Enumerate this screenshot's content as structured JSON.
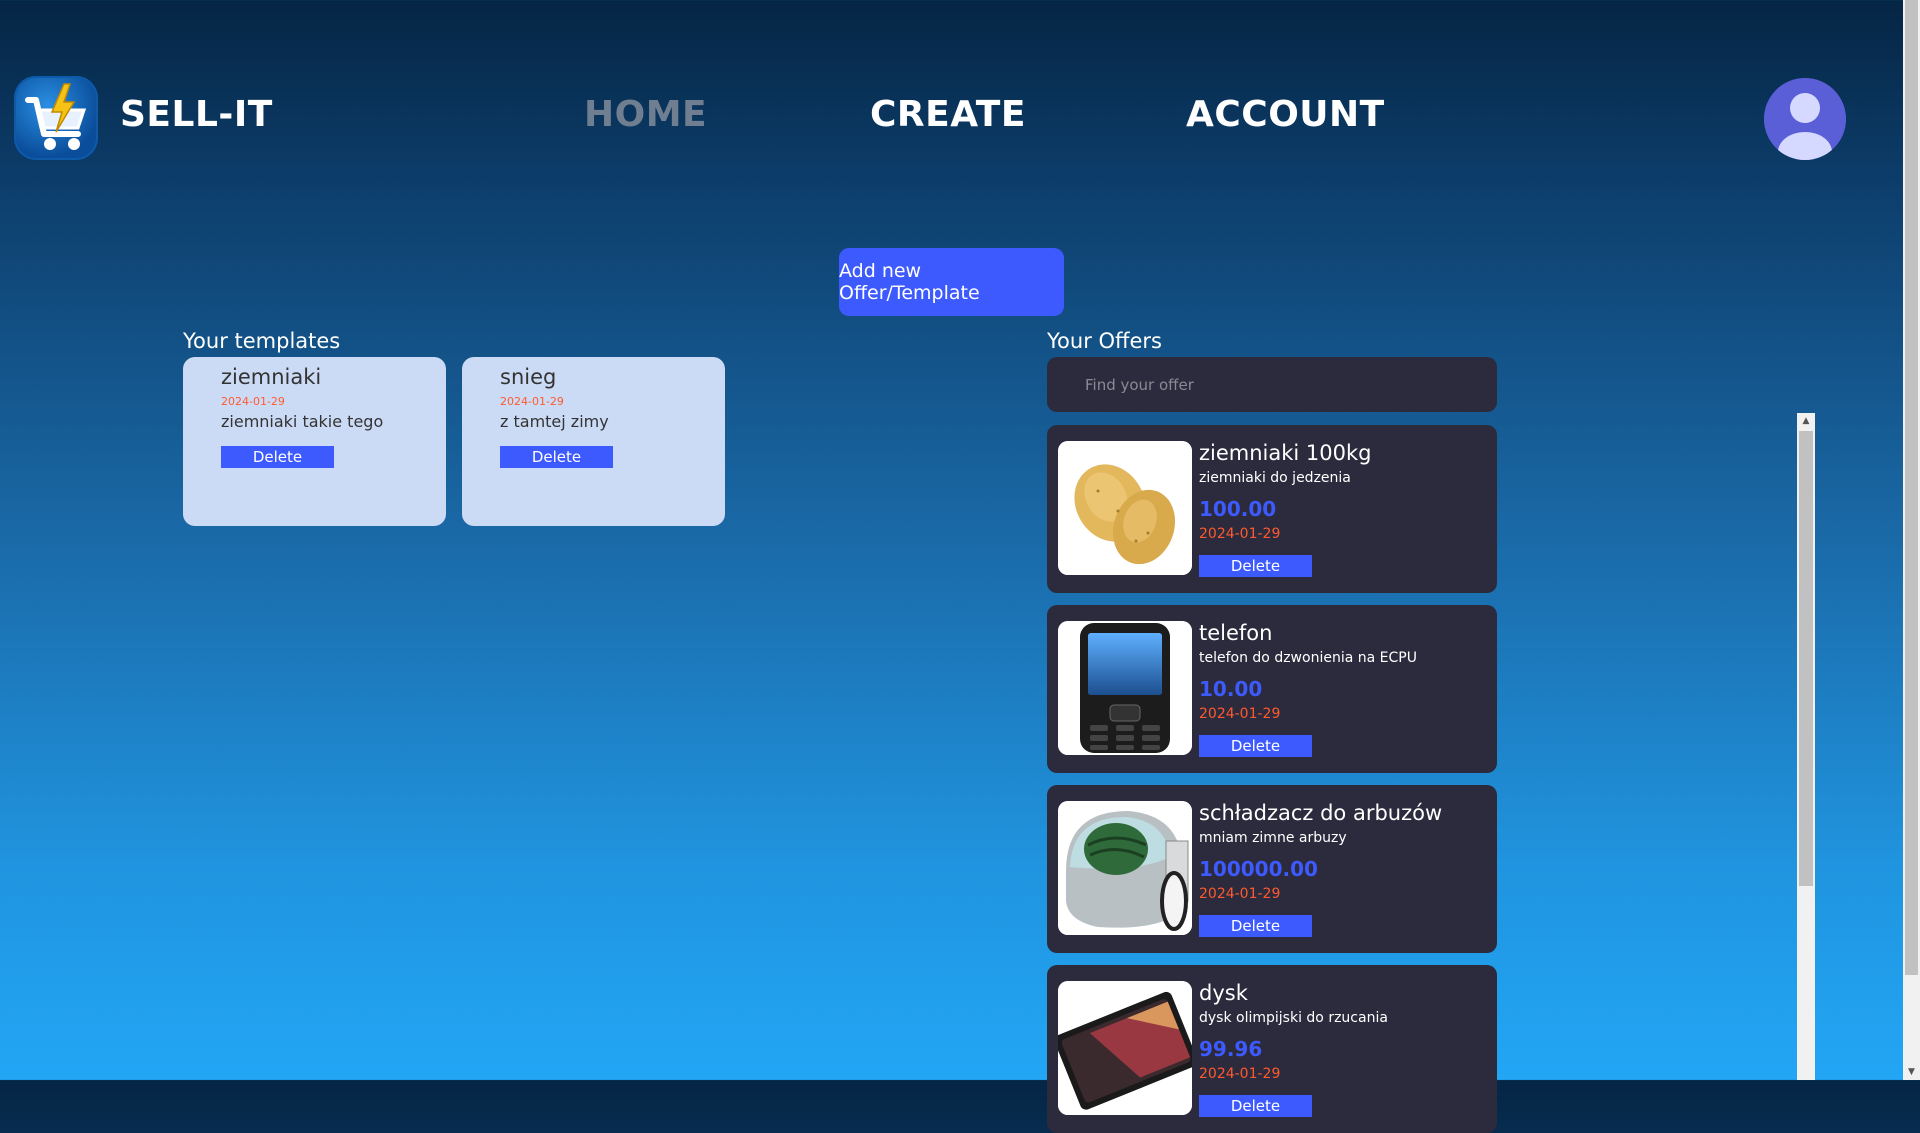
{
  "header": {
    "brand": "SELL-IT",
    "nav": [
      {
        "label": "HOME",
        "active": false
      },
      {
        "label": "CREATE",
        "active": true
      },
      {
        "label": "ACCOUNT",
        "active": true
      }
    ],
    "logo_icon": "shopping-cart-lightning-icon",
    "avatar_icon": "user-avatar-icon"
  },
  "main": {
    "add_button_label": "Add new Offer/Template",
    "templates_title": "Your templates",
    "templates": [
      {
        "name": "ziemniaki",
        "date": "2024-01-29",
        "desc": "ziemniaki takie tego",
        "delete_label": "Delete"
      },
      {
        "name": "snieg",
        "date": "2024-01-29",
        "desc": "z tamtej zimy",
        "delete_label": "Delete"
      }
    ],
    "offers_title": "Your Offers",
    "search_placeholder": "Find your offer",
    "offers": [
      {
        "name": "ziemniaki 100kg",
        "desc": "ziemniaki do jedzenia",
        "price": "100.00",
        "date": "2024-01-29",
        "delete_label": "Delete",
        "image": "potatoes-image"
      },
      {
        "name": "telefon",
        "desc": "telefon do dzwonienia na ECPU",
        "price": "10.00",
        "date": "2024-01-29",
        "delete_label": "Delete",
        "image": "phone-image"
      },
      {
        "name": "schładzacz do arbuzów",
        "desc": "mniam zimne arbuzy",
        "price": "100000.00",
        "date": "2024-01-29",
        "delete_label": "Delete",
        "image": "watermelon-cooler-image"
      },
      {
        "name": "dysk",
        "desc": "dysk olimpijski do rzucania",
        "price": "99.96",
        "date": "2024-01-29",
        "delete_label": "Delete",
        "image": "ssd-image"
      }
    ]
  },
  "colors": {
    "accent": "#3d5afe",
    "date": "#ff5a2e",
    "card_dark": "#2c2b3d",
    "card_light": "#ccdbf5"
  }
}
